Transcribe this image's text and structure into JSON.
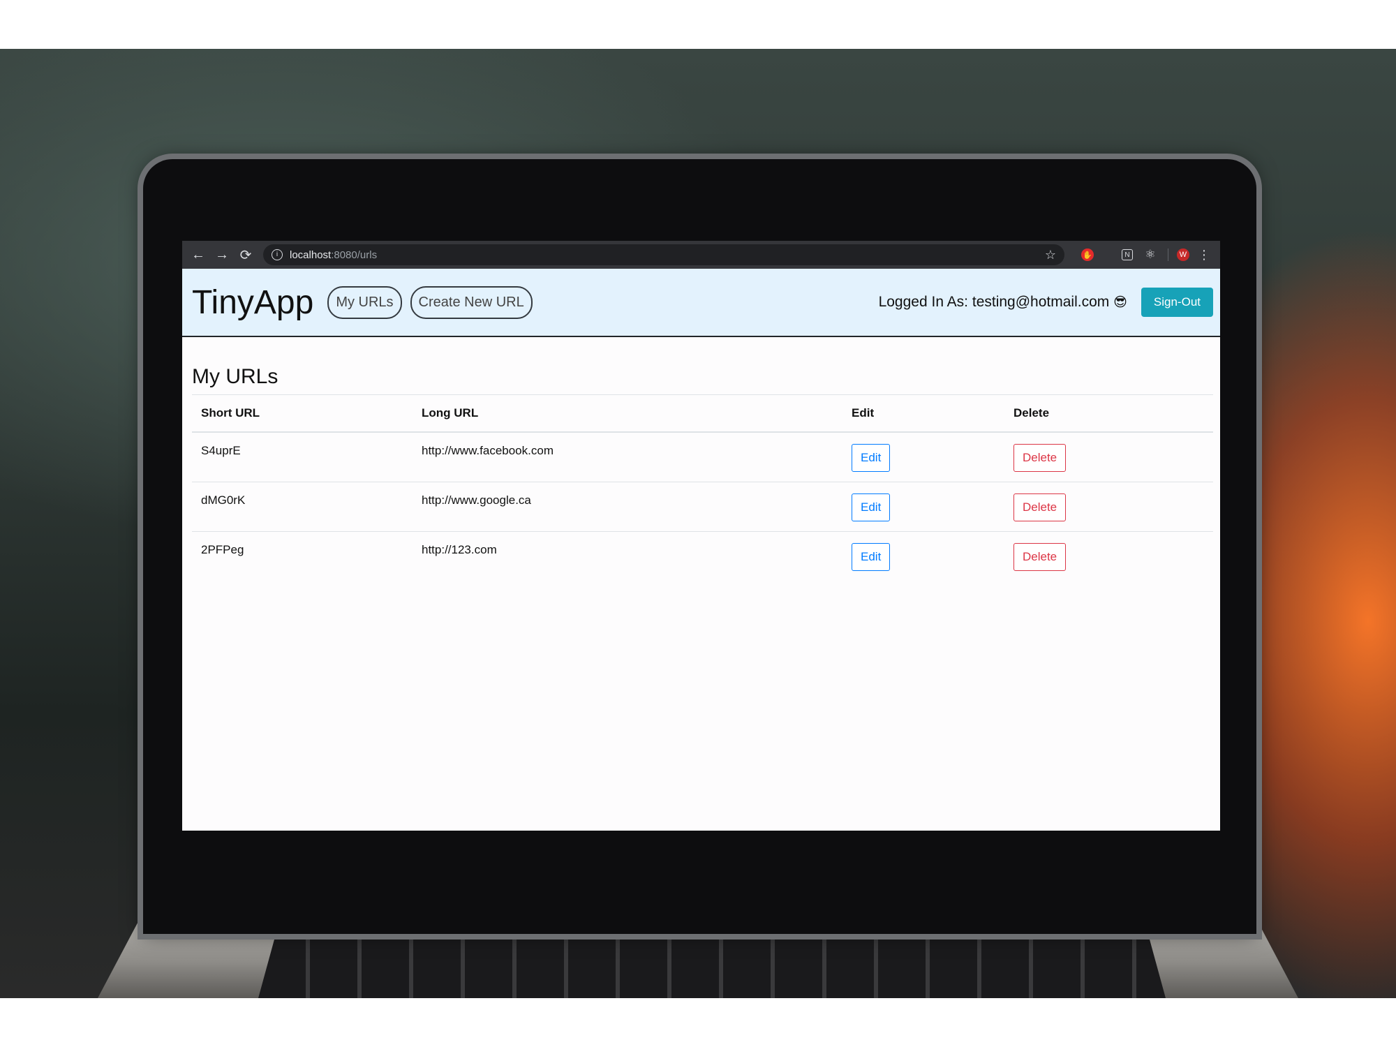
{
  "browser": {
    "url_host": "localhost",
    "url_rest": ":8080/urls",
    "back_icon": "←",
    "forward_icon": "→",
    "reload_icon": "⟳",
    "info_icon": "i",
    "star_icon": "☆",
    "adblock_icon": "✋",
    "notion_icon": "N",
    "react_icon": "⚛",
    "avatar_letter": "W",
    "menu_icon": "⋮"
  },
  "header": {
    "brand": "TinyApp",
    "nav": [
      "My URLs",
      "Create New URL"
    ],
    "logged_in_label": "Logged In As: testing@hotmail.com",
    "logged_in_emoji": "😎",
    "signout_label": "Sign-Out"
  },
  "main": {
    "title": "My URLs",
    "columns": [
      "Short URL",
      "Long URL",
      "Edit",
      "Delete"
    ],
    "rows": [
      {
        "short": "S4uprE",
        "long": "http://www.facebook.com",
        "edit": "Edit",
        "delete": "Delete"
      },
      {
        "short": "dMG0rK",
        "long": "http://www.google.ca",
        "edit": "Edit",
        "delete": "Delete"
      },
      {
        "short": "2PFPeg",
        "long": "http://123.com",
        "edit": "Edit",
        "delete": "Delete"
      }
    ]
  },
  "colors": {
    "header_bg": "#e3f2fd",
    "signout_bg": "#17a2b8",
    "edit_color": "#007bff",
    "delete_color": "#dc3545"
  }
}
